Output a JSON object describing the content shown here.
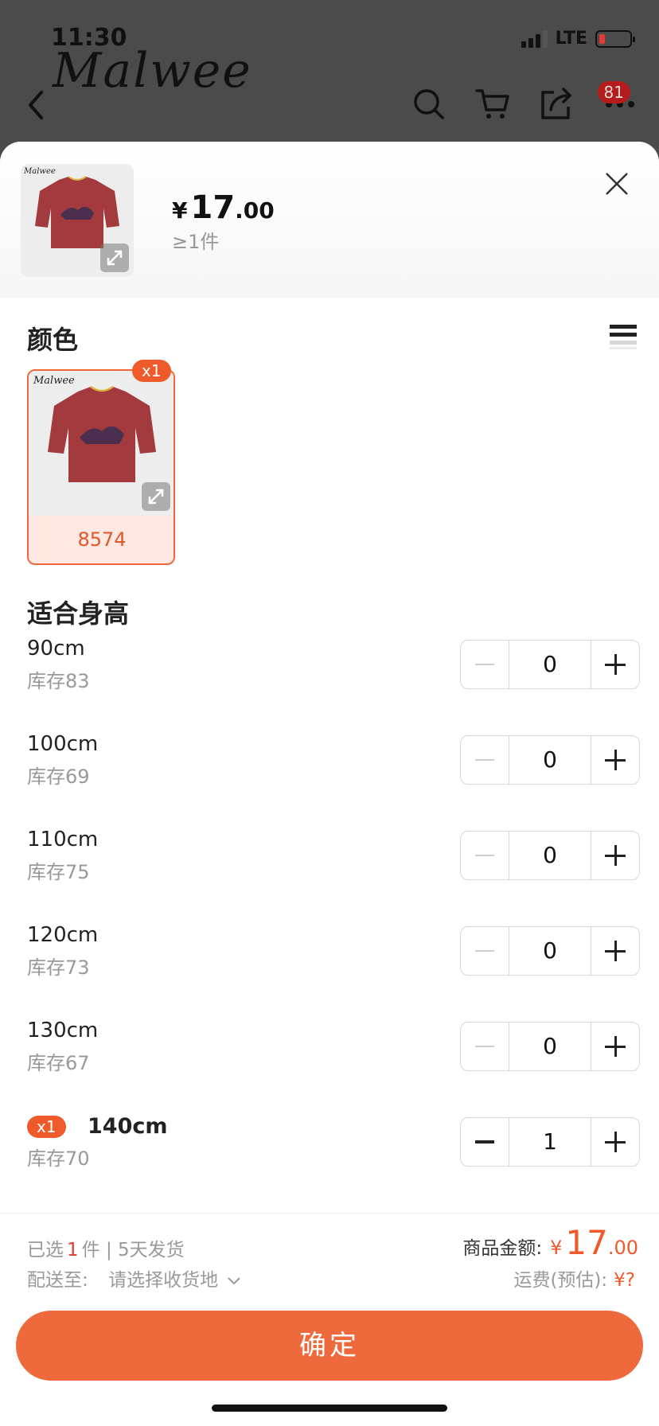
{
  "status_bar": {
    "time": "11:30",
    "network": "LTE"
  },
  "header": {
    "brand": "Malwee",
    "cart_count": "81"
  },
  "product": {
    "currency": "¥",
    "price_int": "17",
    "price_dec": ".00",
    "min_qty": "≥1件"
  },
  "color_section": {
    "title": "颜色",
    "items": [
      {
        "label": "8574",
        "badge": "x1",
        "image_brand": "Malwee"
      }
    ]
  },
  "size_section": {
    "title": "适合身高",
    "rows": [
      {
        "size": "90cm",
        "stock": "库存83",
        "qty": "0"
      },
      {
        "size": "100cm",
        "stock": "库存69",
        "qty": "0"
      },
      {
        "size": "110cm",
        "stock": "库存75",
        "qty": "0"
      },
      {
        "size": "120cm",
        "stock": "库存73",
        "qty": "0"
      },
      {
        "size": "130cm",
        "stock": "库存67",
        "qty": "0"
      },
      {
        "size": "140cm",
        "stock": "库存70",
        "qty": "1",
        "badge": "x1"
      }
    ]
  },
  "footer": {
    "selected_prefix": "已选",
    "selected_count": "1",
    "selected_suffix": "件 | 5天发货",
    "ship_to_label": "配送至:",
    "ship_to_value": "请选择收货地",
    "amount_label": "商品金额:",
    "amount_currency": "¥",
    "amount_int": "17",
    "amount_dec": ".00",
    "freight_label": "运费(预估):",
    "freight_value": "¥?",
    "confirm": "确定"
  },
  "colors": {
    "accent": "#ee6a3c",
    "accent_dark": "#ee5a2a",
    "badge_red": "#b71c1c"
  }
}
